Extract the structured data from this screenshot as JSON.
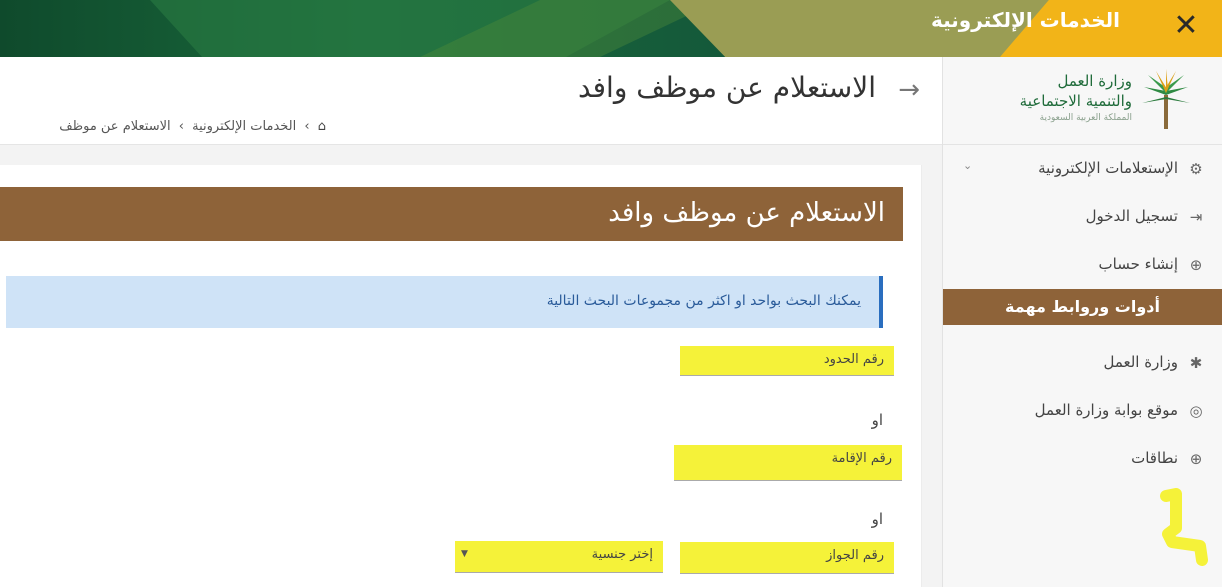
{
  "topbar": {
    "title": "الخدمات الإلكترونية",
    "close_symbol": "✕"
  },
  "logo": {
    "line1": "وزارة العمل",
    "line2": "والتنمية الاجتماعية",
    "line3": "المملكة العربية السعودية"
  },
  "sidebar": {
    "items": [
      {
        "label": "الإستعلامات الإلكترونية",
        "icon": "gears-icon"
      },
      {
        "label": "تسجيل الدخول",
        "icon": "sign-in-icon"
      },
      {
        "label": "إنشاء حساب",
        "icon": "plus-circle-icon"
      }
    ],
    "heading": "أدوات وروابط مهمة",
    "links": [
      {
        "label": "وزارة العمل",
        "icon": "palm-icon"
      },
      {
        "label": "موقع بوابة وزارة العمل",
        "icon": "globe-icon"
      },
      {
        "label": "نطاقات",
        "icon": "plus-circle-icon"
      }
    ]
  },
  "page": {
    "title": "الاستعلام عن موظف وافد",
    "breadcrumb": [
      "الخدمات الإلكترونية",
      "الاستعلام عن موظف"
    ]
  },
  "card": {
    "title": "الاستعلام عن موظف وافد",
    "notice": "يمكنك البحث بواحد او اكثر من مجموعات البحث التالية",
    "field_border": "رقم الحدود",
    "or_1": "او",
    "field_iqama": "رقم الإقامة",
    "or_2": "او",
    "field_passport": "رقم الجواز",
    "select_nationality": "إختر جنسية"
  },
  "colors": {
    "brown": "#8e6339",
    "green": "#1f6b3a",
    "highlight": "#f5f239",
    "notice_bg": "#cfe3f7"
  }
}
